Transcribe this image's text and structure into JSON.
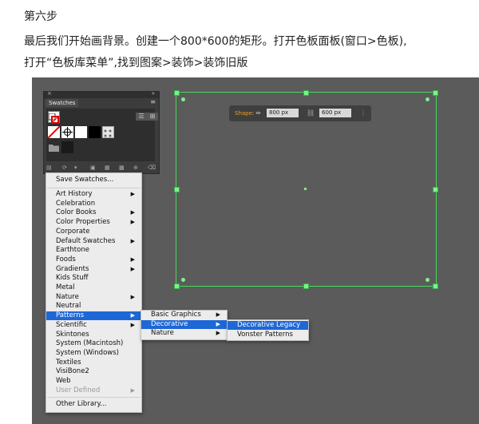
{
  "article": {
    "heading": "第六步",
    "line1": "最后我们开始画背景。创建一个800*600的矩形。打开色板面板(窗口>色板),",
    "line2": "打开“色板库菜单”,找到图案>装饰>装饰旧版"
  },
  "shape_bar": {
    "label": "Shape:",
    "width_value": "800 px",
    "height_value": "600 px"
  },
  "swatches_panel": {
    "title": "Swatches"
  },
  "menus": {
    "library_menu": {
      "save_label": "Save Swatches...",
      "items": [
        {
          "label": "Art History",
          "submenu": true
        },
        {
          "label": "Celebration",
          "submenu": false
        },
        {
          "label": "Color Books",
          "submenu": true
        },
        {
          "label": "Color Properties",
          "submenu": true
        },
        {
          "label": "Corporate",
          "submenu": false
        },
        {
          "label": "Default Swatches",
          "submenu": true
        },
        {
          "label": "Earthtone",
          "submenu": false
        },
        {
          "label": "Foods",
          "submenu": true
        },
        {
          "label": "Gradients",
          "submenu": true
        },
        {
          "label": "Kids Stuff",
          "submenu": false
        },
        {
          "label": "Metal",
          "submenu": false
        },
        {
          "label": "Nature",
          "submenu": true
        },
        {
          "label": "Neutral",
          "submenu": false
        },
        {
          "label": "Patterns",
          "submenu": true,
          "highlighted": true
        },
        {
          "label": "Scientific",
          "submenu": true
        },
        {
          "label": "Skintones",
          "submenu": false
        },
        {
          "label": "System (Macintosh)",
          "submenu": false
        },
        {
          "label": "System (Windows)",
          "submenu": false
        },
        {
          "label": "Textiles",
          "submenu": false
        },
        {
          "label": "VisiBone2",
          "submenu": false
        },
        {
          "label": "Web",
          "submenu": false
        },
        {
          "label": "User Defined",
          "submenu": true,
          "disabled": true
        }
      ],
      "other_label": "Other Library..."
    },
    "patterns_menu": {
      "items": [
        {
          "label": "Basic Graphics",
          "submenu": true
        },
        {
          "label": "Decorative",
          "submenu": true,
          "highlighted": true
        },
        {
          "label": "Nature",
          "submenu": true
        }
      ]
    },
    "decorative_menu": {
      "items": [
        {
          "label": "Decorative Legacy",
          "highlighted": true
        },
        {
          "label": "Vonster Patterns"
        }
      ]
    }
  },
  "colors": {
    "selection": "#46d95e",
    "highlight": "#1e67d6",
    "shape_label": "#f0a020"
  }
}
